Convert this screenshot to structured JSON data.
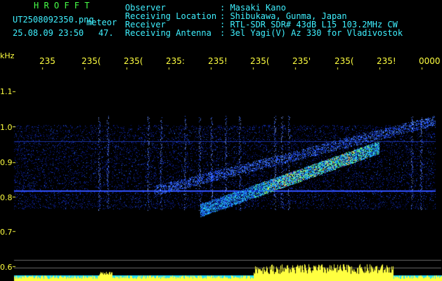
{
  "app_title": "H R O F F T",
  "file_name": "UT2508092350.png",
  "event_label": "meteor",
  "timestamp": "25.08.09 23:50",
  "count": "47.",
  "info": {
    "labels": [
      "Observer",
      "Receiving Location",
      "Receiver",
      "Receiving Antenna"
    ],
    "values": [
      ": Masaki Kano",
      ": Shibukawa, Gunma, Japan",
      ": RTL-SDR SDR# 43dB L15 103.2MHz CW",
      ": 3el Yagi(V) Az 330 for Vladivostok"
    ]
  },
  "y_unit": "kHz",
  "y_ticks": [
    "1.1",
    "1.0",
    "0.9",
    "0.8",
    "0.7",
    "0.6"
  ],
  "x_ticks": [
    "235",
    "235(",
    "235(",
    "235:",
    "235!",
    "235(",
    "235'",
    "235(",
    "235!",
    "0000"
  ],
  "colors": {
    "header_text": "#3ff0ff",
    "axis_text": "#ffff40",
    "title": "#48ff48",
    "background": "#000000"
  }
}
